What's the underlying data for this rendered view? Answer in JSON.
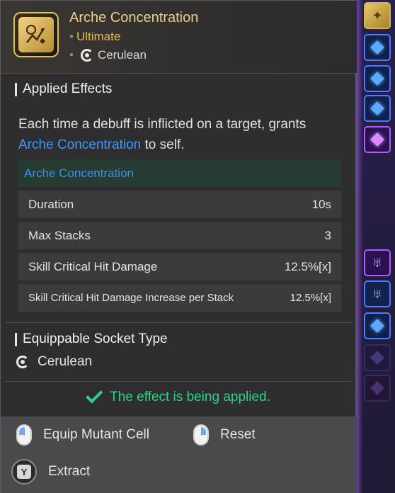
{
  "tooltip": {
    "item": {
      "name": "Arche Concentration",
      "grade": "Ultimate",
      "socket_type": "Cerulean",
      "icon": "arche-concentration-icon",
      "accent_color": "#e0bf55"
    },
    "applied_effects": {
      "title": "Applied Effects",
      "description_prefix": "Each time a debuff is inflicted on a target, grants ",
      "description_highlight": "Arche Concentration",
      "description_suffix": " to self.",
      "effect_name": "Arche Concentration",
      "stats": [
        {
          "label": "Duration",
          "value": "10s"
        },
        {
          "label": "Max Stacks",
          "value": "3"
        },
        {
          "label": "Skill Critical Hit Damage",
          "value": "12.5%[x]"
        },
        {
          "label": "Skill Critical Hit Damage Increase per Stack",
          "value": "12.5%[x]"
        }
      ]
    },
    "equippable_socket": {
      "title": "Equippable Socket Type",
      "value": "Cerulean"
    },
    "status_text": "The effect is being applied.",
    "actions": {
      "equip": "Equip Mutant Cell",
      "reset": "Reset",
      "extract": "Extract",
      "extract_key": "Y"
    }
  },
  "colors": {
    "highlight_blue": "#3a9bff",
    "status_green": "#2fd387",
    "gold": "#e7cf8a"
  }
}
